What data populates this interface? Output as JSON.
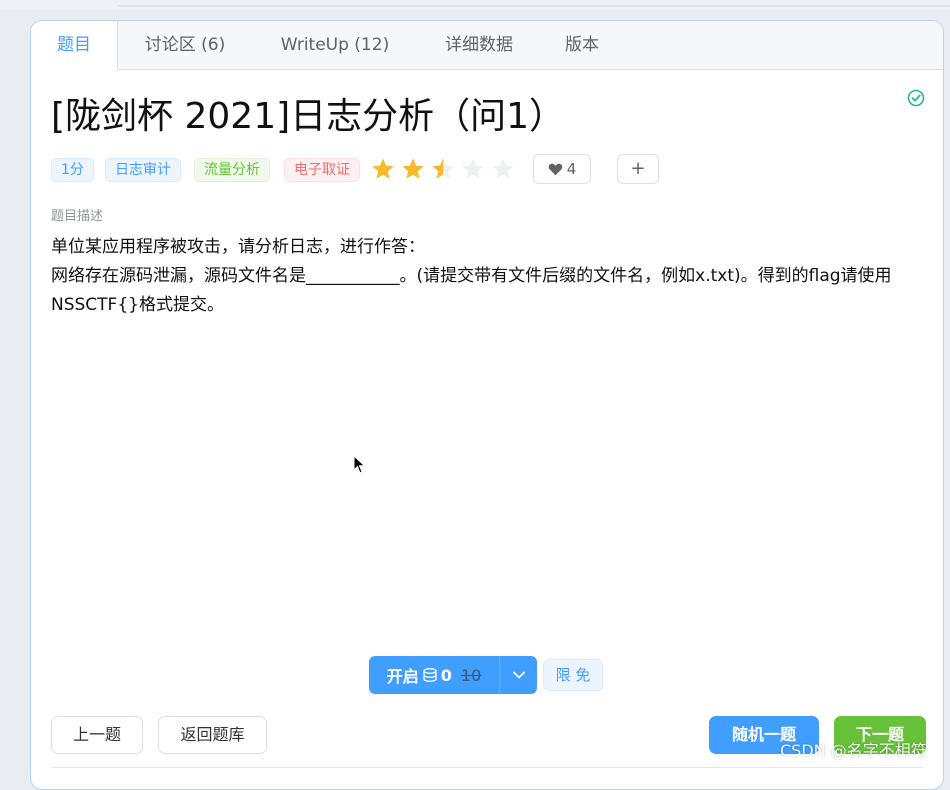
{
  "tabs": [
    {
      "label": "题目"
    },
    {
      "label": "讨论区 (6)"
    },
    {
      "label": "WriteUp (12)"
    },
    {
      "label": "详细数据"
    },
    {
      "label": "版本"
    }
  ],
  "problem": {
    "title": "[陇剑杯 2021]日志分析（问1）",
    "tags": [
      {
        "label": "1分",
        "color": "blue"
      },
      {
        "label": "日志审计",
        "color": "blue"
      },
      {
        "label": "流量分析",
        "color": "green"
      },
      {
        "label": "电子取证",
        "color": "red"
      }
    ],
    "rating": {
      "value": 2.5,
      "max": 5,
      "color": "#f7ba2a"
    },
    "likes": "4",
    "add_label": "+",
    "description_label": "题目描述",
    "description": [
      "单位某应用程序被攻击，请分析日志，进行作答：",
      "网络存在源码泄漏，源码文件名是___________。(请提交带有文件后缀的文件名，例如x.txt)。得到的flag请使用NSSCTF{}格式提交。"
    ]
  },
  "actions": {
    "start_label": "开启",
    "coin_icon": "coins-icon",
    "start_cost": "0",
    "start_original_cost": "10",
    "free_badge": "限 免",
    "prev_label": "上一题",
    "back_label": "返回题库",
    "random_label": "随机一题",
    "next_label": "下一题"
  },
  "watermark": "CSDN @名字不相符",
  "colors": {
    "primary": "#409eff",
    "success": "#67c23a",
    "danger": "#f56c6c",
    "star": "#f7ba2a"
  }
}
